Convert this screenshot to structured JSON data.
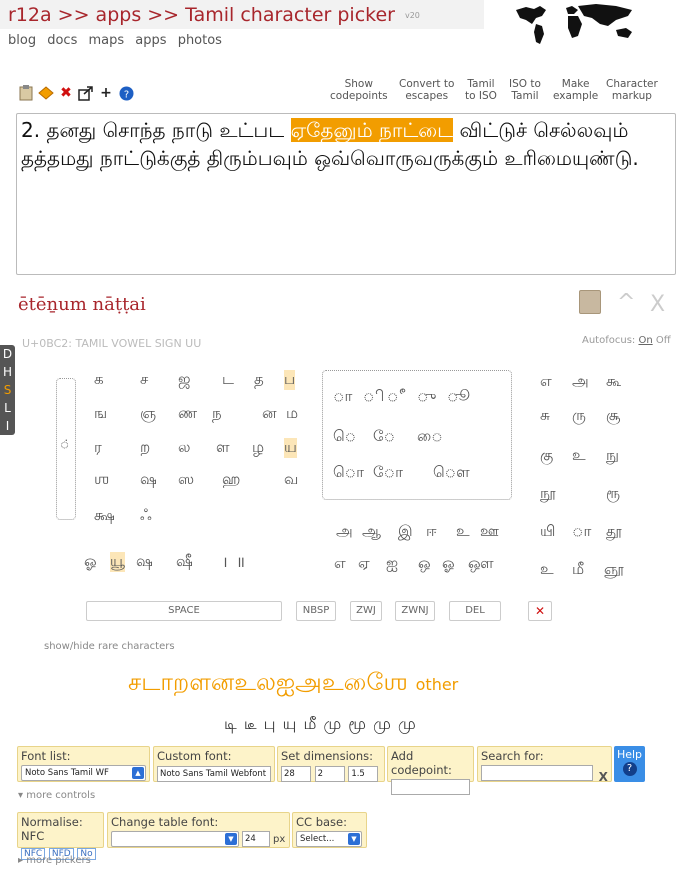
{
  "header": {
    "title": "r12a >> apps >> Tamil character picker",
    "version": "v20",
    "nav": [
      "blog",
      "docs",
      "maps",
      "apps",
      "photos"
    ]
  },
  "toolbar": {
    "icons": [
      "clipboard-icon",
      "eraser-icon",
      "delete-icon",
      "share-icon",
      "plus-icon",
      "help-icon"
    ],
    "options": [
      {
        "line1": "Show",
        "line2": "codepoints"
      },
      {
        "line1": "Convert to",
        "line2": "escapes"
      },
      {
        "line1": "Tamil",
        "line2": "to ISO"
      },
      {
        "line1": "ISO to",
        "line2": "Tamil"
      },
      {
        "line1": "Make",
        "line2": "example"
      },
      {
        "line1": "Character",
        "line2": "markup"
      }
    ]
  },
  "editor": {
    "text_before": "2. தனது சொந்த நாடு உட்பட ",
    "highlight": "ஏதேனும் நாட்டை",
    "text_after": " விட்டுச் செல்லவும் தத்தமது நாட்டுக்குத் திரும்பவும் ஒவ்வொருவருக்கும் உரிமையுண்டு."
  },
  "transliteration": "ētēṉum nāṭṭai",
  "char_info": "U+0BC2: TAMIL VOWEL SIGN UU",
  "autofocus": {
    "label": "Autofocus:",
    "on": "On",
    "off": "Off"
  },
  "side_tabs": [
    "D",
    "H",
    "S",
    "L",
    "I"
  ],
  "consonants": [
    "க",
    "ச",
    "ஜ",
    "ட",
    "த",
    "ப",
    "ங",
    "ஞ",
    "ண",
    "ந",
    "ன",
    "ம",
    "ர",
    "ற",
    "ல",
    "ள",
    "ழ",
    "ய",
    "ஶ",
    "ஷ",
    "ஸ",
    "ஹ",
    "வ",
    "க்ஷ",
    "ஃ"
  ],
  "vowel_signs": [
    "ா",
    "ி",
    "ீ",
    "ு",
    "ூ",
    "ெ",
    "ே",
    "ை",
    "ொ",
    "ோ",
    "ௌ"
  ],
  "right_glyphs": [
    "எ",
    "அ",
    "கூ",
    "சு",
    "ரு",
    "சூ",
    "கு",
    "உ",
    "நு",
    "நூ",
    "ரூ",
    "யி",
    "ா",
    "தூ",
    "உ",
    "மீ",
    "ஞூ"
  ],
  "vowels_row1": [
    "அ",
    "ஆ",
    "இ",
    "ஈ",
    "உ",
    "ஊ"
  ],
  "vowels_row2": [
    "எ",
    "ஏ",
    "ஐ",
    "ஒ",
    "ஓ",
    "ஔ"
  ],
  "misc_row": [
    "ஓ",
    "யூ",
    "ஷ",
    "ஷீ",
    "।",
    "॥"
  ],
  "buttons": {
    "space": "SPACE",
    "nbsp": "NBSP",
    "zwj": "ZWJ",
    "zwnj": "ZWNJ",
    "del": "DEL",
    "clear": "✕"
  },
  "rare_link": "show/hide rare characters",
  "rare_chars": "சடாறளனஉலஐஅஉஶேை",
  "other_label": "other",
  "small_row": "டி டீ பு யு மீ மு மூ மு மு",
  "controls": {
    "font_list": {
      "label": "Font list:",
      "value": "Noto Sans Tamil WF"
    },
    "custom_font": {
      "label": "Custom font:",
      "value": "Noto Sans Tamil Webfont"
    },
    "dimensions": {
      "label": "Set dimensions:",
      "v1": "28",
      "v2": "2",
      "v3": "1.5"
    },
    "add_codepoint": {
      "label": "Add codepoint:"
    },
    "search": {
      "label": "Search for:",
      "clear": "X"
    },
    "help": {
      "label": "Help",
      "icon": "?"
    },
    "more_controls": "more controls",
    "normalise": {
      "label": "Normalise: NFC",
      "opts": [
        "NFC",
        "NFD",
        "No"
      ]
    },
    "table_font": {
      "label": "Change table font:",
      "size": "24",
      "unit": "px"
    },
    "cc_base": {
      "label": "CC base:",
      "value": "Select..."
    },
    "more_pickers": "more pickers"
  }
}
